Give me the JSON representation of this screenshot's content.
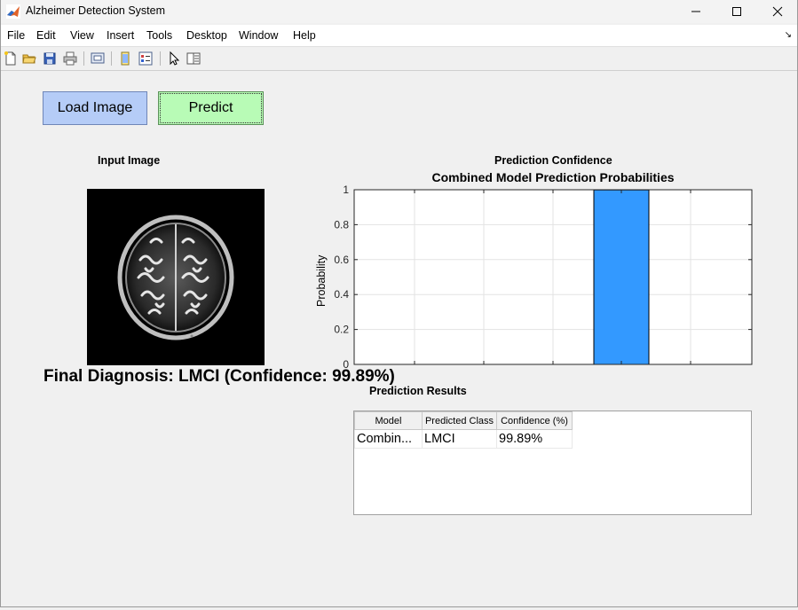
{
  "window": {
    "title": "Alzheimer Detection System",
    "controls": [
      "minimize",
      "maximize",
      "close"
    ]
  },
  "menu": [
    "File",
    "Edit",
    "View",
    "Insert",
    "Tools",
    "Desktop",
    "Window",
    "Help"
  ],
  "toolbar": {
    "icons": [
      "new-file-icon",
      "open-folder-icon",
      "save-icon",
      "print-icon",
      "print-preview-icon",
      "link-plot-icon",
      "insert-legend-icon",
      "edit-plot-arrow-icon",
      "property-inspector-icon"
    ]
  },
  "buttons": {
    "load_label": "Load Image",
    "predict_label": "Predict",
    "load_color": "#b5ccf7",
    "predict_color": "#b8fbb6"
  },
  "input_panel": {
    "title": "Input Image"
  },
  "diagnosis": {
    "text": "Final Diagnosis: LMCI (Confidence: 99.89%)"
  },
  "chart_panel": {
    "title": "Prediction Confidence"
  },
  "chart_data": {
    "type": "bar",
    "title": "Combined Model Prediction Probabilities",
    "xlabel": "",
    "ylabel": "Probability",
    "ylim": [
      0,
      1
    ],
    "yticks": [
      "0",
      "0.2",
      "0.4",
      "0.6",
      "0.8",
      "1"
    ],
    "num_categories": 5,
    "values": [
      0,
      0,
      0,
      0.9989,
      0
    ],
    "bar_color": "#3399ff",
    "grid": true
  },
  "results": {
    "title": "Prediction Results",
    "columns": [
      "Model",
      "Predicted Class",
      "Confidence (%)"
    ],
    "rows": [
      [
        "Combin...",
        "LMCI",
        "99.89%"
      ]
    ]
  }
}
